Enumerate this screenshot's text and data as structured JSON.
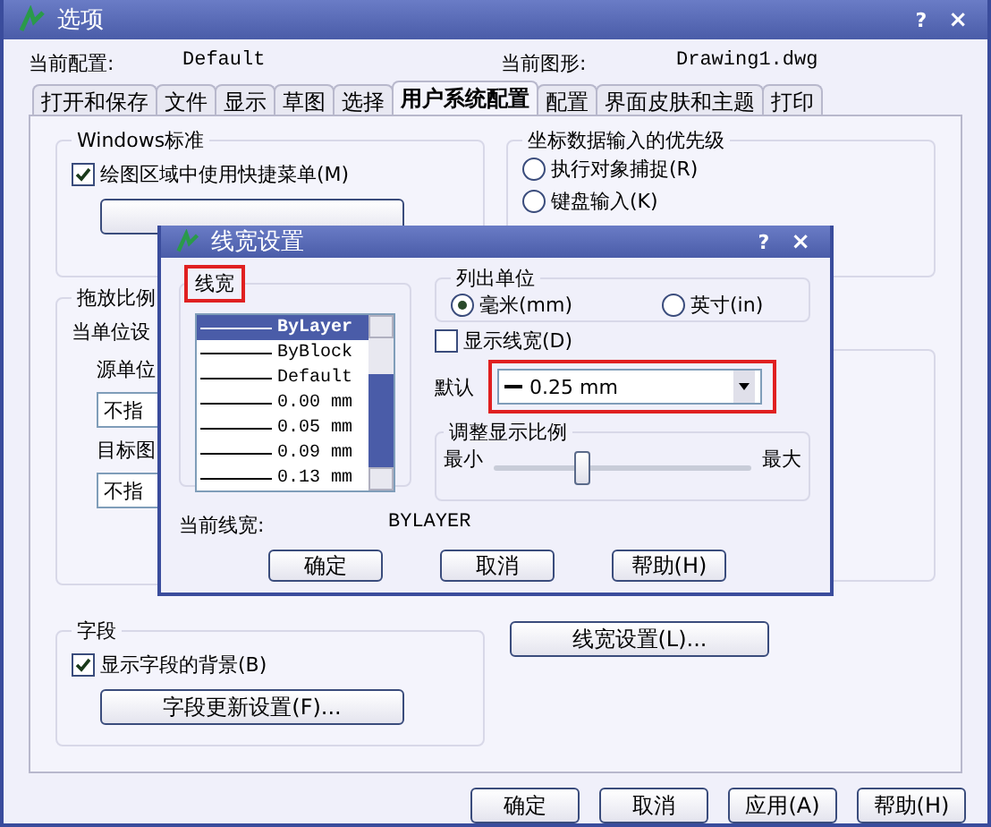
{
  "window": {
    "title": "选项",
    "help": "?",
    "close": "×"
  },
  "profile": {
    "label": "当前配置:",
    "value": "Default"
  },
  "drawing": {
    "label": "当前图形:",
    "value": "Drawing1.dwg"
  },
  "tabs": [
    {
      "label": "打开和保存",
      "selected": false
    },
    {
      "label": "文件",
      "selected": false
    },
    {
      "label": "显示",
      "selected": false
    },
    {
      "label": "草图",
      "selected": false
    },
    {
      "label": "选择",
      "selected": false
    },
    {
      "label": "用户系统配置",
      "selected": true
    },
    {
      "label": "配置",
      "selected": false
    },
    {
      "label": "界面皮肤和主题",
      "selected": false
    },
    {
      "label": "打印",
      "selected": false
    }
  ],
  "windows_standard": {
    "title": "Windows标准",
    "checkbox": {
      "label": "绘图区域中使用快捷菜单(M)",
      "checked": true
    }
  },
  "coordinate_priority": {
    "title": "坐标数据输入的优先级",
    "options": [
      {
        "label": "执行对象捕捉(R)",
        "selected": false
      },
      {
        "label": "键盘输入(K)",
        "selected": false
      }
    ]
  },
  "insertion_scale": {
    "title": "拖放比例",
    "label": "当单位设",
    "source_label": "源单位",
    "source_value": "不指",
    "target_label": "目标图",
    "target_value": "不指"
  },
  "fields": {
    "title": "字段",
    "checkbox": {
      "label": "显示字段的背景(B)",
      "checked": true
    },
    "button": "字段更新设置(F)..."
  },
  "lineweight_button": "线宽设置(L)...",
  "buttons": [
    "确定",
    "取消",
    "应用(A)",
    "帮助(H)"
  ],
  "dialog": {
    "title": "线宽设置",
    "help": "?",
    "close": "×",
    "list_title": "线宽",
    "items": [
      {
        "label": "ByLayer",
        "selected": true
      },
      {
        "label": "ByBlock",
        "selected": false
      },
      {
        "label": "Default",
        "selected": false
      },
      {
        "label": "0.00 mm",
        "selected": false
      },
      {
        "label": "0.05 mm",
        "selected": false
      },
      {
        "label": "0.09 mm",
        "selected": false
      },
      {
        "label": "0.13 mm",
        "selected": false
      }
    ],
    "units": {
      "title": "列出单位",
      "options": [
        {
          "label": "毫米(mm)",
          "selected": true
        },
        {
          "label": "英寸(in)",
          "selected": false
        }
      ]
    },
    "display": {
      "label": "显示线宽(D)",
      "checked": false
    },
    "default": {
      "label": "默认",
      "value": "0.25 mm"
    },
    "scale": {
      "title": "调整显示比例",
      "min_label": "最小",
      "max_label": "最大",
      "level": 0.34
    },
    "current": {
      "label": "当前线宽:",
      "value": "BYLAYER"
    },
    "buttons": [
      "确定",
      "取消",
      "帮助(H)"
    ]
  }
}
